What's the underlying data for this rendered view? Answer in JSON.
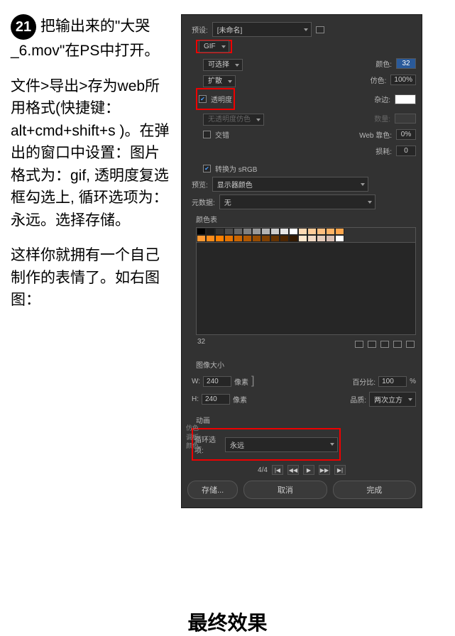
{
  "left": {
    "step_number": "21",
    "step_text_1": " 把输出来的\"大哭_6.mov\"在PS中打开。",
    "para1": "文件>导出>存为web所用格式(快捷键：alt+cmd+shift+s )。在弹出的窗口中设置：图片格式为：gif, 透明度复选框勾选上, 循环选项为：永远。选择存储。",
    "para2": "这样你就拥有一个自己制作的表情了。如右图图："
  },
  "panel": {
    "preset_label": "预设:",
    "preset_value": "[未命名]",
    "format_value": "GIF",
    "selectable_label": "可选择",
    "colors_label": "颜色:",
    "colors_value": "32",
    "diffusion_label": "扩散",
    "dither_label": "仿色:",
    "dither_value": "100%",
    "transparency_label": "透明度",
    "matte_label": "杂边:",
    "no_trans_dither_label": "无透明度仿色",
    "amount_label": "数量:",
    "interlaced_label": "交错",
    "web_snap_label": "Web 靠色:",
    "web_snap_value": "0%",
    "lossy_label": "损耗:",
    "lossy_value": "0",
    "convert_srgb_label": "转换为 sRGB",
    "preview_label": "预览:",
    "preview_value": "显示器颜色",
    "metadata_label": "元数据:",
    "metadata_value": "无",
    "color_table_label": "颜色表",
    "color_count": "32",
    "image_size_label": "图像大小",
    "width_label": "W:",
    "width_value": "240",
    "height_label": "H:",
    "height_value": "240",
    "px_label": "像素",
    "percent_label": "百分比:",
    "percent_value": "100",
    "percent_unit": "%",
    "quality_label": "品质:",
    "quality_value": "两次立方",
    "anim_label": "动画",
    "loop_label": "循环选项:",
    "loop_value": "永远",
    "frame_count": "4/4",
    "save_btn": "存储...",
    "cancel_btn": "取消",
    "done_btn": "完成",
    "side_tab1": "仿色",
    "side_tab2": "调板",
    "side_tab3": "颜色"
  },
  "final_title": "最终效果",
  "palette": [
    "#000000",
    "#1a1a1a",
    "#333333",
    "#4d4d4d",
    "#666666",
    "#808080",
    "#999999",
    "#b3b3b3",
    "#cccccc",
    "#e6e6e6",
    "#ffffff",
    "#ffd9b3",
    "#ffcc99",
    "#ffbf80",
    "#ffb366",
    "#ffa64d",
    "#ff9933",
    "#ff8c1a",
    "#ff8000",
    "#e67300",
    "#cc6600",
    "#b35900",
    "#994d00",
    "#804000",
    "#663300",
    "#4d2600",
    "#331a00",
    "#ffe6cc",
    "#f2d9c4",
    "#e6ccbb",
    "#d9bfb3",
    "#ffffff"
  ]
}
